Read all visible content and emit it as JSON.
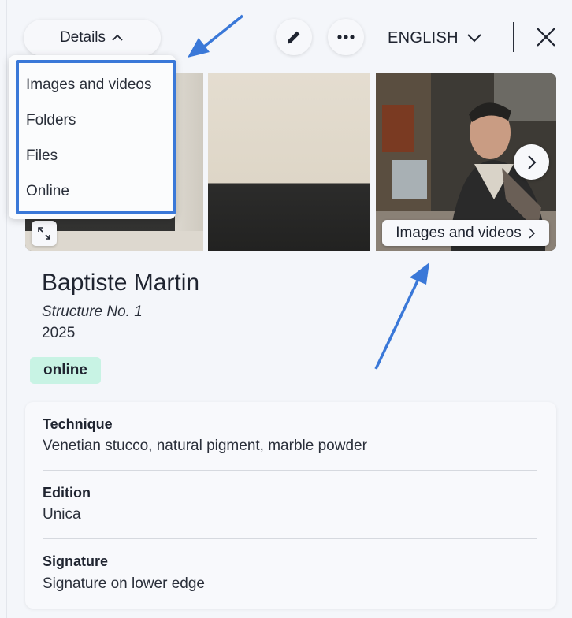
{
  "header": {
    "details_label": "Details",
    "language_label": "ENGLISH"
  },
  "dropdown": {
    "items": [
      {
        "label": "Images and videos"
      },
      {
        "label": "Folders"
      },
      {
        "label": "Files"
      },
      {
        "label": "Online"
      }
    ]
  },
  "gallery": {
    "media_chip_label": "Images and videos"
  },
  "artwork": {
    "artist": "Baptiste Martin",
    "title": "Structure No. 1",
    "year": "2025",
    "status": "online"
  },
  "details": [
    {
      "label": "Technique",
      "value": "Venetian stucco, natural pigment, marble powder"
    },
    {
      "label": "Edition",
      "value": "Unica"
    },
    {
      "label": "Signature",
      "value": "Signature on lower edge"
    }
  ],
  "colors": {
    "highlight": "#3a78d8",
    "status_bg": "#c8f3e4",
    "background": "#f4f6fa"
  },
  "icons": [
    "chevron-up-icon",
    "pencil-icon",
    "more-icon",
    "chevron-down-icon",
    "close-icon",
    "expand-icon",
    "chevron-right-icon"
  ]
}
